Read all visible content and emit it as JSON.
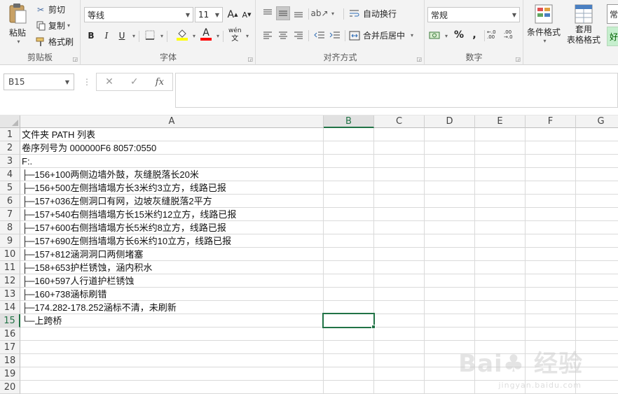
{
  "ribbon": {
    "clipboard": {
      "paste": "粘贴",
      "cut": "剪切",
      "copy": "复制",
      "format_painter": "格式刷",
      "label": "剪贴板"
    },
    "font": {
      "name": "等线",
      "size": "11",
      "grow": "A",
      "shrink": "A",
      "bold": "B",
      "italic": "I",
      "underline": "U",
      "font_color_glyph": "A",
      "phonetic": "wén",
      "phonetic_sub": "文",
      "label": "字体",
      "fill_color": "#ffff00",
      "font_color": "#ff0000"
    },
    "alignment": {
      "wrap_text": "自动换行",
      "merge_center": "合并后居中",
      "label": "对齐方式"
    },
    "number": {
      "format": "常规",
      "percent": "%",
      "comma": ",",
      "inc_decimal": "←.0 .00",
      "dec_decimal": ".00 →.0",
      "label": "数字"
    },
    "styles": {
      "conditional_format": "条件格式",
      "table_format_1": "套用",
      "table_format_2": "表格格式",
      "style_normal": "常",
      "style_good": "好"
    }
  },
  "formula_bar": {
    "name_box": "B15",
    "cancel": "✕",
    "enter": "✓",
    "fx": "fx",
    "content": ""
  },
  "columns": [
    "A",
    "B",
    "C",
    "D",
    "E",
    "F",
    "G"
  ],
  "selected_column": "B",
  "rows": [
    "1",
    "2",
    "3",
    "4",
    "5",
    "6",
    "7",
    "8",
    "9",
    "10",
    "11",
    "12",
    "13",
    "14",
    "15",
    "16",
    "17",
    "18",
    "19",
    "20"
  ],
  "selected_row": "15",
  "cells_A": [
    "文件夹 PATH 列表",
    "卷序列号为 000000F6 8057:0550",
    "F:.",
    "├─156+100两侧边墙外鼓，灰缝脱落长20米",
    "├─156+500左侧挡墙塌方长3米约3立方，线路已报",
    "├─157+036左侧洞口有网，边坡灰缝脱落2平方",
    "├─157+540右侧挡墙塌方长15米约12立方，线路已报",
    "├─157+600右侧挡墙塌方长5米约8立方，线路已报",
    "├─157+690左侧挡墙塌方长6米约10立方，线路已报",
    "├─157+812涵洞洞口两侧堵塞",
    "├─158+653护栏锈蚀，涵内积水",
    "├─160+597人行道护栏锈蚀",
    "├─160+738涵标刷错",
    "├─174.282-178.252涵标不清，未刷新",
    "└─上跨桥",
    "",
    "",
    "",
    "",
    ""
  ],
  "accent_color": "#217346"
}
